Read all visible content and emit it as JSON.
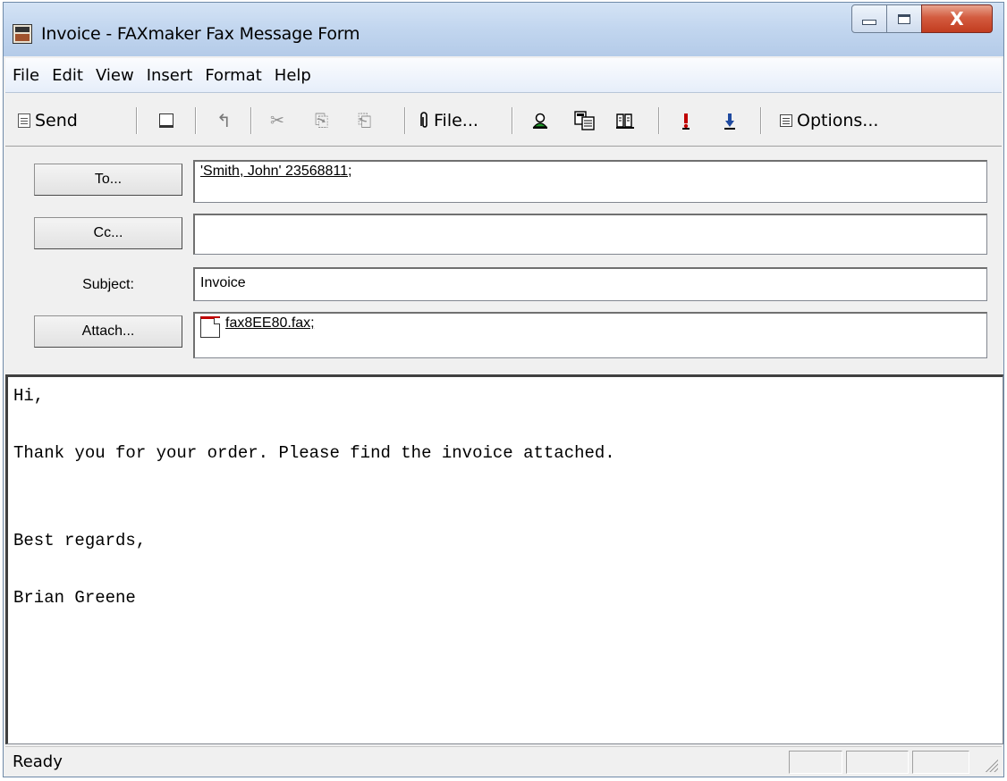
{
  "window": {
    "title": "Invoice - FAXmaker Fax Message Form",
    "close_glyph": "X"
  },
  "menu": [
    "File",
    "Edit",
    "View",
    "Insert",
    "Format",
    "Help"
  ],
  "toolbar": {
    "send_label": "Send",
    "file_label": "File...",
    "options_label": "Options...",
    "cut_glyph": "✂",
    "copy_glyph": "⎘",
    "paste_glyph": "⎗",
    "undo_glyph": "↰"
  },
  "header": {
    "to_button": "To...",
    "to_value": "'Smith, John' 23568811;",
    "cc_button": "Cc...",
    "cc_value": "",
    "subject_label": "Subject:",
    "subject_value": "Invoice",
    "attach_button": "Attach...",
    "attach_value": "fax8EE80.fax;"
  },
  "body": {
    "lines": [
      "Hi,",
      "Thank you for your order. Please find the invoice attached.",
      "Best regards,",
      "Brian Greene"
    ]
  },
  "status": {
    "text": "Ready"
  },
  "colors": {
    "title_bar": "#c2d6ef",
    "close_button": "#c94a2c",
    "attachment_icon_accent": "#c00000"
  },
  "icons": [
    "fax-app-icon",
    "send-icon",
    "new-icon",
    "undo-icon",
    "cut-icon",
    "copy-icon",
    "paste-icon",
    "paperclip-icon",
    "address-book-icon",
    "check-names-icon",
    "address-list-icon",
    "high-priority-icon",
    "low-priority-icon",
    "options-icon",
    "fax-file-icon"
  ]
}
